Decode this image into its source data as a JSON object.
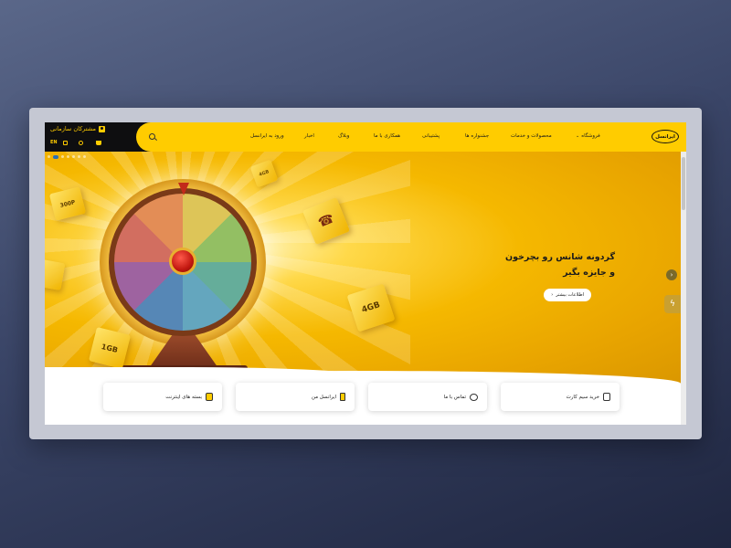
{
  "header": {
    "org_login": "مشترکان سازمانی",
    "lang": "EN",
    "logo_text": "ایرانسل",
    "nav": [
      "ورود به ایرانسل",
      "اخبار",
      "وبلاگ",
      "همکاری با ما",
      "پشتیبانی",
      "جشنواره ها",
      "محصولات و خدمات",
      "فروشگاه"
    ]
  },
  "hero": {
    "title_line1": "گردونه شانس رو بچرخون",
    "title_line2": "و جایزه بگیر",
    "more_button": "اطلاعات بیشتر",
    "cube_labels": [
      "4GB",
      "1GB",
      "4GB",
      "300P"
    ]
  },
  "quick_cards": [
    {
      "label": "خرید سیم کارت",
      "icon": "sim-card-icon"
    },
    {
      "label": "تماس با ما",
      "icon": "chat-icon"
    },
    {
      "label": "ایرانسل من",
      "icon": "phone-icon"
    },
    {
      "label": "بسته های اینترنت",
      "icon": "internet-package-icon"
    }
  ],
  "colors": {
    "brand_yellow": "#ffcc00",
    "header_dark": "#0e0e10"
  }
}
